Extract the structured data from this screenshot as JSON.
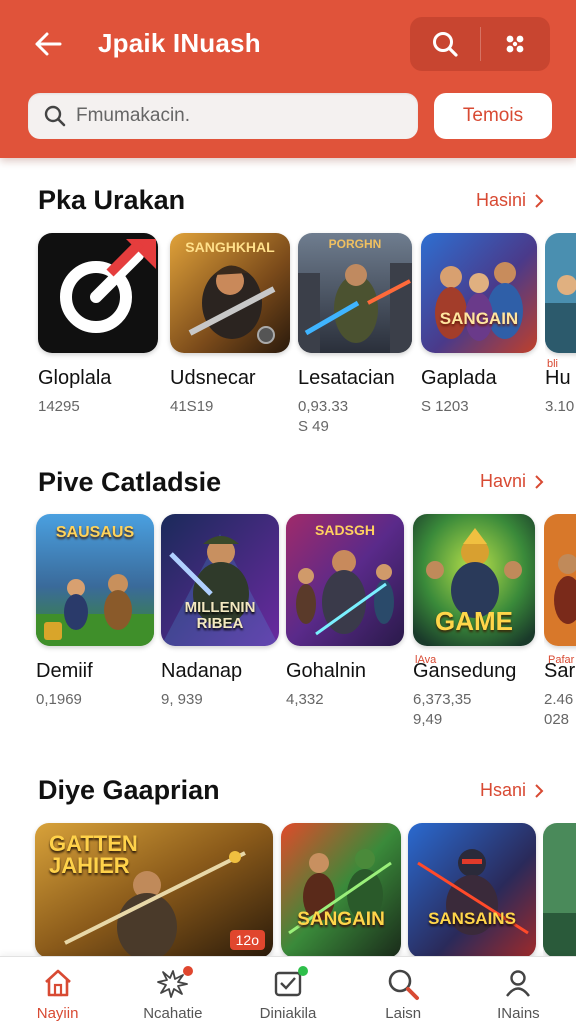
{
  "header": {
    "title": "Jpaik INuash",
    "search_placeholder": "Fmumakacin.",
    "pill_label": "Temois",
    "icons": [
      "back-arrow-icon",
      "search-icon",
      "apps-icon"
    ],
    "color": "#e0533a"
  },
  "sections": [
    {
      "title": "Pka Urakan",
      "see_all": "Hasini",
      "items": [
        {
          "name": "Gloplala",
          "meta": "14295",
          "meta2": ""
        },
        {
          "name": "Udsnecar",
          "meta": "41S19",
          "meta2": ""
        },
        {
          "name": "Lesatacian",
          "meta": "0,93.33",
          "meta2": "S 49"
        },
        {
          "name": "Gaplada",
          "meta": "S 1203",
          "meta2": ""
        },
        {
          "name": "Hu",
          "meta": "3.10",
          "meta2": "",
          "tag": "bli"
        }
      ]
    },
    {
      "title": "Pive Catladsie",
      "see_all": "Havni",
      "items": [
        {
          "name": "Demiif",
          "meta": "0,1969",
          "meta2": ""
        },
        {
          "name": "Nadanap",
          "meta": "9, 939",
          "meta2": ""
        },
        {
          "name": "Gohalnin",
          "meta": "4,332",
          "meta2": ""
        },
        {
          "name": "Gansedung",
          "meta": "6,373,35",
          "meta2": "9,49",
          "tag": "lAva"
        },
        {
          "name": "Sar",
          "meta": "2.46",
          "meta2": "028",
          "tag": "Pafar"
        }
      ]
    },
    {
      "title": "Diye Gaaprian",
      "see_all": "Hsani",
      "items": [
        {
          "name": "",
          "meta": "",
          "meta2": "",
          "badge": "12o"
        }
      ]
    }
  ],
  "thumb_texts": {
    "s1c2": "SANGHKHAL",
    "s1c3": "PORGHN",
    "s1c4": "SANGAIN",
    "s2c1": "SAUSAUS",
    "s2c2": "MILLENIN RIBEA",
    "s2c3": "SADSGH",
    "s2c4": "GAME",
    "s3c1": "GATTEN JAHIER",
    "s3c2": "SANGAIN",
    "s3c3": "SANSAINS"
  },
  "bottom_nav": [
    {
      "label": "Nayiin",
      "icon": "home-icon",
      "active": true
    },
    {
      "label": "Ncahatie",
      "icon": "splat-icon",
      "active": false
    },
    {
      "label": "Diniakila",
      "icon": "inbox-icon",
      "active": false
    },
    {
      "label": "Laisn",
      "icon": "search-icon",
      "active": false
    },
    {
      "label": "INains",
      "icon": "profile-icon",
      "active": false
    }
  ]
}
